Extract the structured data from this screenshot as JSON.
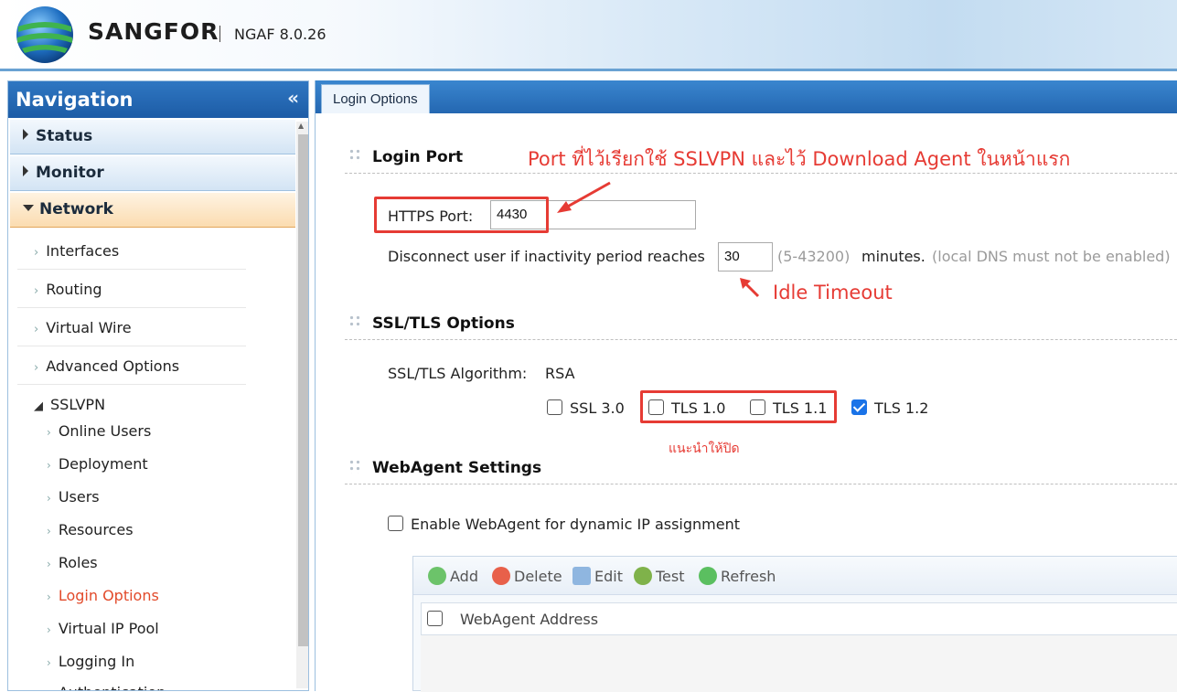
{
  "header": {
    "brand": "SANGFOR",
    "product": "NGAF 8.0.26"
  },
  "nav": {
    "title": "Navigation",
    "collapse_icon": "«",
    "categories": [
      {
        "label": "Status"
      },
      {
        "label": "Monitor"
      },
      {
        "label": "Network"
      }
    ],
    "network_items": [
      {
        "label": "Interfaces"
      },
      {
        "label": "Routing"
      },
      {
        "label": "Virtual Wire"
      },
      {
        "label": "Advanced Options"
      },
      {
        "label": "SSLVPN"
      }
    ],
    "sslvpn_items": [
      {
        "label": "Online Users"
      },
      {
        "label": "Deployment"
      },
      {
        "label": "Users"
      },
      {
        "label": "Resources"
      },
      {
        "label": "Roles"
      },
      {
        "label": "Login Options"
      },
      {
        "label": "Virtual IP Pool"
      },
      {
        "label": "Logging In"
      },
      {
        "label": "Authentication"
      }
    ]
  },
  "main": {
    "tab": "Login Options",
    "login_port": {
      "title": "Login Port",
      "https_label": "HTTPS Port:",
      "https_value": "4430",
      "disconnect_label": "Disconnect user if inactivity period reaches",
      "disconnect_value": "30",
      "range": "(5-43200)",
      "minutes": "minutes.",
      "note": "(local DNS must not be enabled)"
    },
    "ssl": {
      "title": "SSL/TLS Options",
      "algorithm_label": "SSL/TLS Algorithm:",
      "algorithm_value": "RSA",
      "options": [
        {
          "label": "SSL 3.0",
          "checked": false
        },
        {
          "label": "TLS 1.0",
          "checked": false
        },
        {
          "label": "TLS 1.1",
          "checked": false
        },
        {
          "label": "TLS 1.2",
          "checked": true
        }
      ]
    },
    "webagent": {
      "title": "WebAgent Settings",
      "enable_label": "Enable WebAgent for dynamic IP assignment",
      "toolbar": {
        "add": "Add",
        "delete": "Delete",
        "edit": "Edit",
        "test": "Test",
        "refresh": "Refresh"
      },
      "column": "WebAgent Address"
    }
  },
  "annotations": {
    "port_note": "Port ที่ไว้เรียกใช้ SSLVPN และไว้ Download Agent ในหน้าแรก",
    "idle": "Idle Timeout",
    "recommend": "แนะนำให้ปิด"
  },
  "colors": {
    "accent_blue": "#2467b1",
    "annotation_red": "#e63b34",
    "current_nav": "#e24a2a"
  }
}
